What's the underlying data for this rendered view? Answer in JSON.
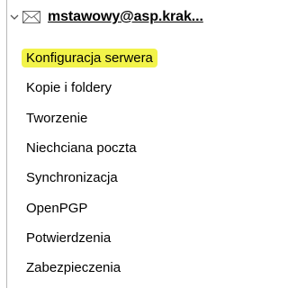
{
  "account": {
    "label": "mstawowy@asp.krak...",
    "expanded_icon": "chevron-down-icon",
    "type_icon": "envelope-icon"
  },
  "settings_items": [
    {
      "label": "Konfiguracja serwera",
      "selected": true
    },
    {
      "label": "Kopie i foldery",
      "selected": false
    },
    {
      "label": "Tworzenie",
      "selected": false
    },
    {
      "label": "Niechciana poczta",
      "selected": false
    },
    {
      "label": "Synchronizacja",
      "selected": false
    },
    {
      "label": "OpenPGP",
      "selected": false
    },
    {
      "label": "Potwierdzenia",
      "selected": false
    },
    {
      "label": "Zabezpieczenia",
      "selected": false
    }
  ],
  "colors": {
    "highlight": "#f2f34a",
    "tree_line": "#b9b9b9",
    "text": "#000000"
  }
}
